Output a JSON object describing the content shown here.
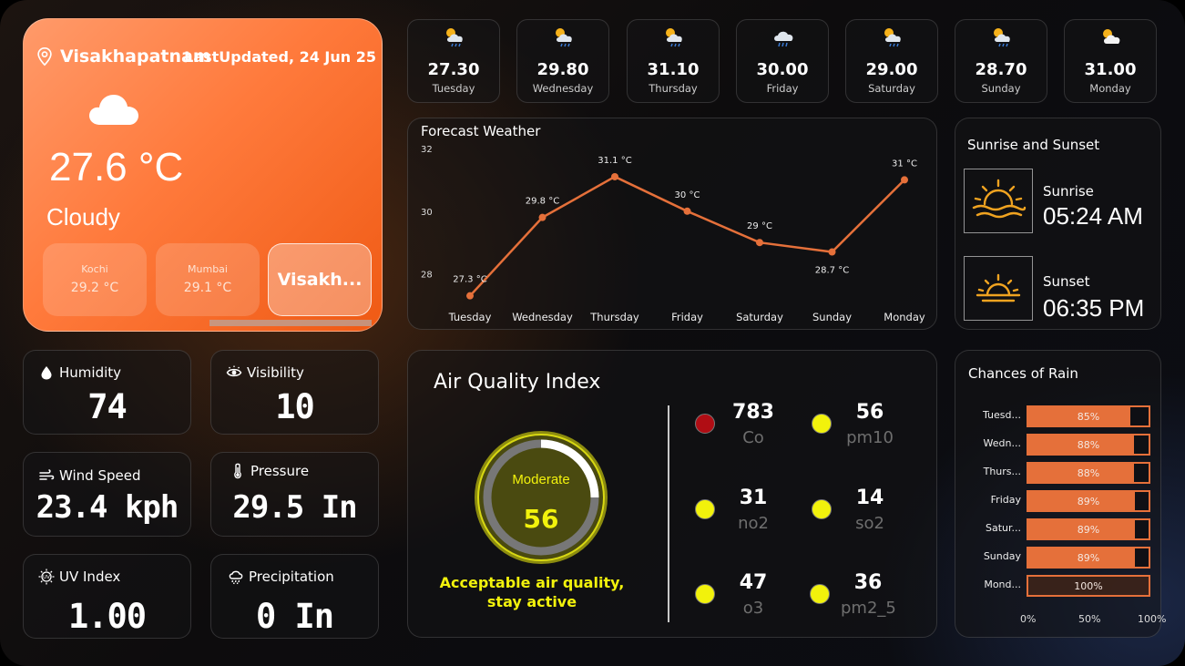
{
  "location": {
    "city": "Visakhapatnam",
    "last_updated": "LastUpdated, 24 Jun 25"
  },
  "current": {
    "temperature": "27.6 °C",
    "condition": "Cloudy",
    "icon": "cloud-icon"
  },
  "cities": [
    {
      "name": "Kochi",
      "temp": "29.2 °C"
    },
    {
      "name": "Mumbai",
      "temp": "29.1 °C"
    },
    {
      "name": "Visakh..."
    }
  ],
  "days": [
    {
      "value": "27.30",
      "day": "Tuesday",
      "icon": "sun-cloud-rain-icon"
    },
    {
      "value": "29.80",
      "day": "Wednesday",
      "icon": "sun-cloud-rain-icon"
    },
    {
      "value": "31.10",
      "day": "Thursday",
      "icon": "sun-cloud-rain-icon"
    },
    {
      "value": "30.00",
      "day": "Friday",
      "icon": "cloud-rain-icon"
    },
    {
      "value": "29.00",
      "day": "Saturday",
      "icon": "sun-cloud-rain-icon"
    },
    {
      "value": "28.70",
      "day": "Sunday",
      "icon": "sun-cloud-rain-icon"
    },
    {
      "value": "31.00",
      "day": "Monday",
      "icon": "sun-cloud-icon"
    }
  ],
  "forecast": {
    "title": "Forecast Weather"
  },
  "sun": {
    "title": "Sunrise and Sunset",
    "sunrise_label": "Sunrise",
    "sunrise_time": "05:24 AM",
    "sunset_label": "Sunset",
    "sunset_time": "06:35 PM"
  },
  "metrics": {
    "humidity": {
      "label": "Humidity",
      "value": "74"
    },
    "visibility": {
      "label": "Visibility",
      "value": "10"
    },
    "wind": {
      "label": "Wind Speed",
      "value": "23.4 kph"
    },
    "pressure": {
      "label": "Pressure",
      "value": "29.5 In"
    },
    "uv": {
      "label": "UV Index",
      "value": "1.00"
    },
    "precip": {
      "label": "Precipitation",
      "value": "0 In"
    }
  },
  "aqi": {
    "title": "Air Quality Index",
    "status": "Moderate",
    "value": "56",
    "gauge_fraction": 0.25,
    "note": "Acceptable air quality, stay active",
    "pollutants": [
      {
        "value": "783",
        "name": "Co",
        "color": "#b00d14"
      },
      {
        "value": "56",
        "name": "pm10",
        "color": "#f2f20c"
      },
      {
        "value": "31",
        "name": "no2",
        "color": "#f2f20c"
      },
      {
        "value": "14",
        "name": "so2",
        "color": "#f2f20c"
      },
      {
        "value": "47",
        "name": "o3",
        "color": "#f2f20c"
      },
      {
        "value": "36",
        "name": "pm2_5",
        "color": "#f2f20c"
      }
    ]
  },
  "rain": {
    "title": "Chances of Rain",
    "rows": [
      {
        "label": "Tuesd...",
        "value": 85,
        "text": "85%"
      },
      {
        "label": "Wedn...",
        "value": 88,
        "text": "88%"
      },
      {
        "label": "Thurs...",
        "value": 88,
        "text": "88%"
      },
      {
        "label": "Friday",
        "value": 89,
        "text": "89%"
      },
      {
        "label": "Satur...",
        "value": 89,
        "text": "89%"
      },
      {
        "label": "Sunday",
        "value": 89,
        "text": "89%"
      },
      {
        "label": "Mond...",
        "value": 100,
        "text": "100%"
      }
    ],
    "axis": [
      "0%",
      "50%",
      "100%"
    ]
  },
  "chart_data": {
    "type": "line",
    "title": "Forecast Weather",
    "categories": [
      "Tuesday",
      "Wednesday",
      "Thursday",
      "Friday",
      "Saturday",
      "Sunday",
      "Monday"
    ],
    "values": [
      27.3,
      29.8,
      31.1,
      30.0,
      29.0,
      28.7,
      31.0
    ],
    "labels": [
      "27.3 °C",
      "29.8 °C",
      "31.1 °C",
      "30 °C",
      "29 °C",
      "28.7 °C",
      "31 °C"
    ],
    "yticks": [
      "28",
      "30",
      "32"
    ],
    "ylim": [
      27,
      32
    ],
    "color": "#e5703a"
  },
  "colors": {
    "accent": "#e5703a",
    "aqi_yellow": "#f2f20c"
  }
}
